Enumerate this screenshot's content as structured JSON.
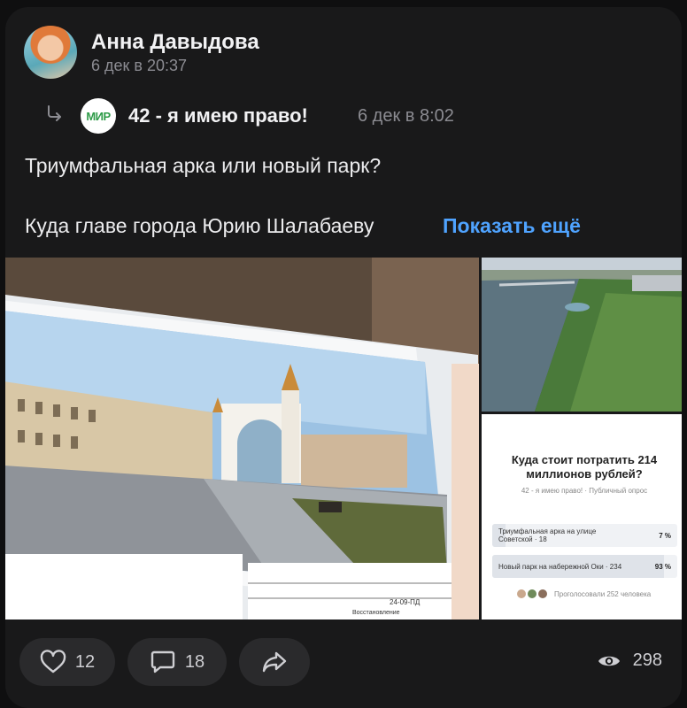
{
  "post": {
    "author": "Анна Давыдова",
    "date": "6 дек в 20:37",
    "repost": {
      "logo_text": "МИР",
      "source": "42 - я имею право!",
      "date": "6 дек в 8:02"
    },
    "text_line1": "Триумфальная арка или новый парк?",
    "text_line2": "Куда главе города Юрию Шалабаеву",
    "show_more": "Показать ещё"
  },
  "attachments": {
    "photo_main_label": "24-09-ПД",
    "photo_main_caption": "Восстановление",
    "poll": {
      "question": "Куда стоит потратить 214 миллионов рублей?",
      "meta": "42 - я имею право! · Публичный опрос",
      "options": [
        {
          "label": "Триумфальная арка на улице Советской · 18",
          "percent": "7 %",
          "share": 0.07
        },
        {
          "label": "Новый парк на набережной Оки · 234",
          "percent": "93 %",
          "share": 0.93
        }
      ],
      "voters": "Проголосовали 252 человека"
    }
  },
  "actions": {
    "likes": "12",
    "comments": "18",
    "views": "298"
  },
  "icons": [
    "repost-icon",
    "heart-icon",
    "comment-icon",
    "share-icon",
    "eye-icon"
  ],
  "colors": {
    "accent": "#4fa3ff",
    "background": "#19191a",
    "button": "#2a2a2c"
  }
}
